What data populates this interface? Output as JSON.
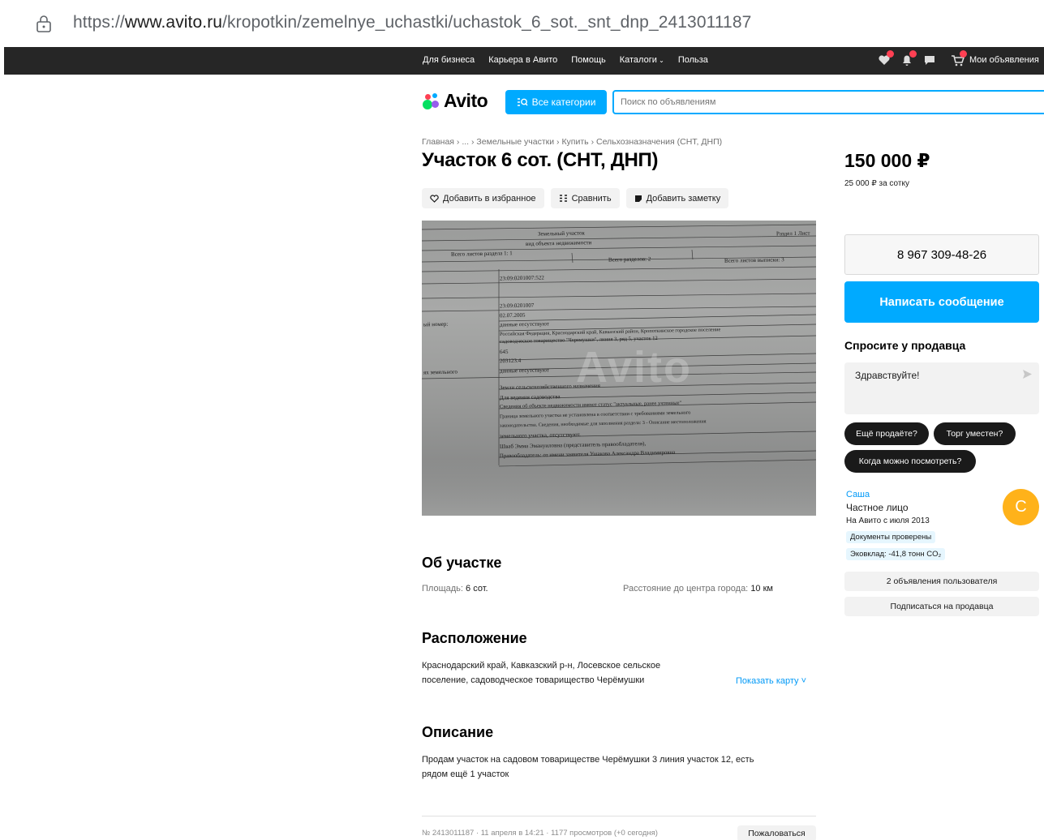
{
  "browser": {
    "url_scheme": "https://",
    "url_host": "www.avito.ru",
    "url_path": "/kropotkin/zemelnye_uchastki/uchastok_6_sot._snt_dnp_2413011187"
  },
  "topnav": {
    "links": [
      "Для бизнеса",
      "Карьера в Авито",
      "Помощь",
      "Каталоги",
      "Польза"
    ],
    "my_ads": "Мои объявления"
  },
  "header": {
    "logo_text": "Avito",
    "categories_button": "Все категории",
    "search_placeholder": "Поиск по объявлениям"
  },
  "breadcrumbs": [
    "Главная",
    "...",
    "Земельные участки",
    "Купить",
    "Сельхозназначения (СНТ, ДНП)"
  ],
  "listing": {
    "title": "Участок 6 сот. (СНТ, ДНП)",
    "actions": {
      "favorite": "Добавить в избранное",
      "compare": "Сравнить",
      "note": "Добавить заметку"
    },
    "photo_text": [
      "Земельный участок",
      "вид объекта недвижимости",
      "Раздел 1 Лист",
      "Всего листов раздела 1: 1",
      "Всего разделов: 2",
      "Всего листов выписки: 3",
      "23:09:0201007:522",
      "23:09:0201007",
      "02.07.2005",
      "ый номер:",
      "данные отсутствуют",
      "Российская Федерация, Краснодарский край, Кавказский район, Кропоткинское городское поселение",
      "садоводческое товарищество \"Черемушки\", линия 3, ряд 5, участок 12",
      "645",
      "203123.4",
      "ях земельного",
      "данные отсутствуют",
      "Земли сельскохозяйственного назначения",
      "Для ведения садоводства",
      "Сведения об объекте недвижимости имеют статус \"актуальные, ранее учтенные\"",
      "Граница земельного участка не установлена в соответствии с требованиями земельного",
      "законодательства. Сведения, необходимые для заполнения раздела: 3 - Описание местоположения",
      "земельного участка, отсутствуют.",
      "Шваб Эмма Эмануиловна (представитель правообладателя),",
      "Правообладатель: от имени заявителя Ушакова Александра Владимировна"
    ],
    "photo_watermark": "Avito",
    "about": {
      "heading": "Об участке",
      "area_label": "Площадь:",
      "area_value": "6 сот.",
      "distance_label": "Расстояние до центра города:",
      "distance_value": "10 км"
    },
    "location": {
      "heading": "Расположение",
      "address_line1": "Краснодарский край, Кавказский р-н, Лосевское сельское",
      "address_line2": "поселение, садоводческое товарищество Черёмушки",
      "map_link": "Показать карту ˅"
    },
    "description": {
      "heading": "Описание",
      "line1": "Продам участок на садовом товариществе Черёмушки 3 линия участок 12, есть",
      "line2": "рядом ещё 1 участок"
    },
    "meta": "№ 2413011187 · 11 апреля в 14:21 · 1177 просмотров (+0 сегодня)",
    "complain": "Пожаловаться"
  },
  "sidebar": {
    "price": "150 000 ₽",
    "price_per_area": "25 000 ₽ за сотку",
    "phone": "8 967 309-48-26",
    "write_message": "Написать сообщение",
    "ask_title": "Спросите у продавца",
    "ask_placeholder": "Здравствуйте!",
    "quick_questions": [
      "Ещё продаёте?",
      "Торг уместен?",
      "Когда можно посмотреть?"
    ],
    "seller": {
      "name": "Саша",
      "type": "Частное лицо",
      "since": "На Авито с июля 2013",
      "tag_docs": "Документы проверены",
      "tag_eco": "Эковклад: -41,8 тонн CO₂",
      "avatar_letter": "С",
      "ads_count": "2 объявления пользователя",
      "subscribe": "Подписаться на продавца"
    }
  },
  "colors": {
    "accent": "#00aaff",
    "nav_bg": "#262626",
    "badge": "#ff4053",
    "avatar": "#ffb21a",
    "link": "#0099f7"
  }
}
